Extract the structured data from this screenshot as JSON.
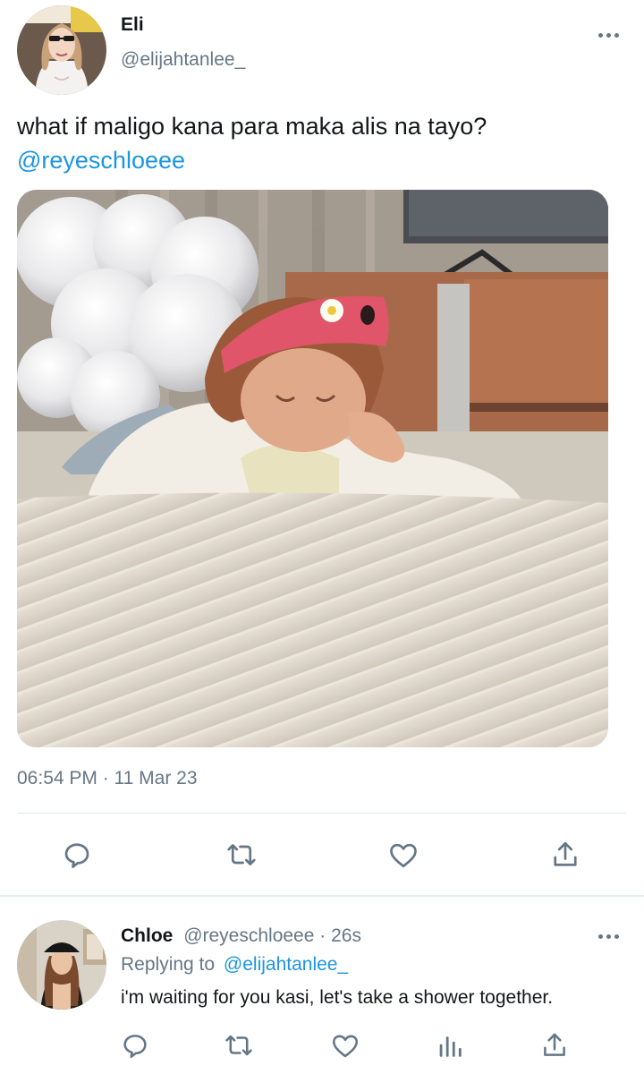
{
  "tweet": {
    "author": {
      "display_name": "Eli",
      "handle": "@elijahtanlee_"
    },
    "text": "what if maligo kana para maka alis na tayo?",
    "mention": "@reyeschloeee",
    "timestamp": "06:54 PM · 11 Mar 23",
    "actions": [
      "reply-icon",
      "retweet-icon",
      "like-icon",
      "share-icon"
    ]
  },
  "reply": {
    "author": {
      "display_name": "Chloe",
      "handle": "@reyeschloeee"
    },
    "separator": " · ",
    "time_ago": "26s",
    "replying_to_label": "Replying to",
    "replying_to_handle": "@elijahtanlee_",
    "text": "i'm waiting for you kasi, let's take a shower together.",
    "actions": [
      "reply-icon",
      "retweet-icon",
      "like-icon",
      "analytics-icon",
      "share-icon"
    ]
  },
  "colors": {
    "link": "#1b95e0",
    "muted": "#657786",
    "icon": "#657786",
    "divider": "#e1e8ed"
  }
}
